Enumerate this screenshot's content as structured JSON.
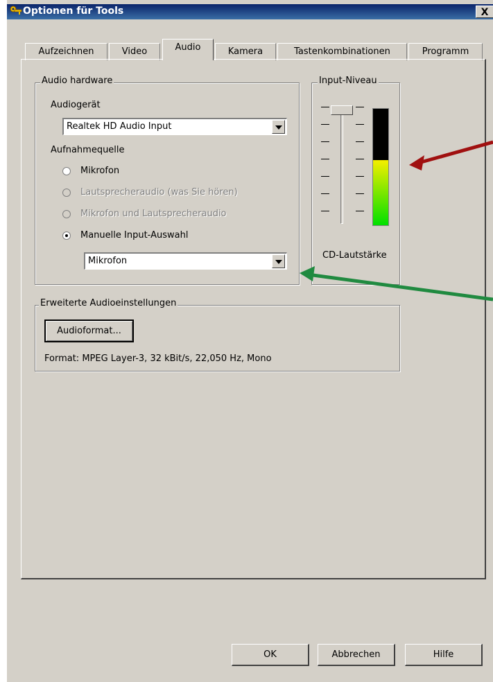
{
  "window": {
    "title": "Optionen für Tools",
    "close_label": "X"
  },
  "tabs": [
    {
      "label": "Aufzeichnen"
    },
    {
      "label": "Video"
    },
    {
      "label": "Audio"
    },
    {
      "label": "Kamera"
    },
    {
      "label": "Tastenkombinationen"
    },
    {
      "label": "Programm"
    }
  ],
  "active_tab": "Audio",
  "audio_hardware": {
    "legend": "Audio hardware",
    "device_label": "Audiogerät",
    "device_value": "Realtek HD Audio Input",
    "source_label": "Aufnahmequelle",
    "radios": [
      {
        "label": "Mikrofon",
        "checked": false,
        "disabled": false
      },
      {
        "label": "Lautsprecheraudio (was Sie hören)",
        "checked": false,
        "disabled": true
      },
      {
        "label": "Mikrofon und Lautsprecheraudio",
        "checked": false,
        "disabled": true
      },
      {
        "label": "Manuelle Input-Auswahl",
        "checked": true,
        "disabled": false
      }
    ],
    "manual_input_value": "Mikrofon"
  },
  "input_level": {
    "legend": "Input-Niveau",
    "slider_label": "CD-Lautstärke",
    "meter_fill_fraction": 0.56,
    "meter_colors": {
      "top": "#f5ee00",
      "bottom": "#00e000",
      "empty": "#000000"
    }
  },
  "advanced_audio": {
    "legend": "Erweiterte Audioeinstellungen",
    "format_button": "Audioformat...",
    "format_text": "Format: MPEG Layer-3, 32 kBit/s, 22,050 Hz, Mono"
  },
  "buttons": {
    "ok": "OK",
    "cancel": "Abbrechen",
    "help": "Hilfe"
  },
  "annotation_arrows": [
    {
      "color": "#a01010"
    },
    {
      "color": "#208a40"
    }
  ]
}
